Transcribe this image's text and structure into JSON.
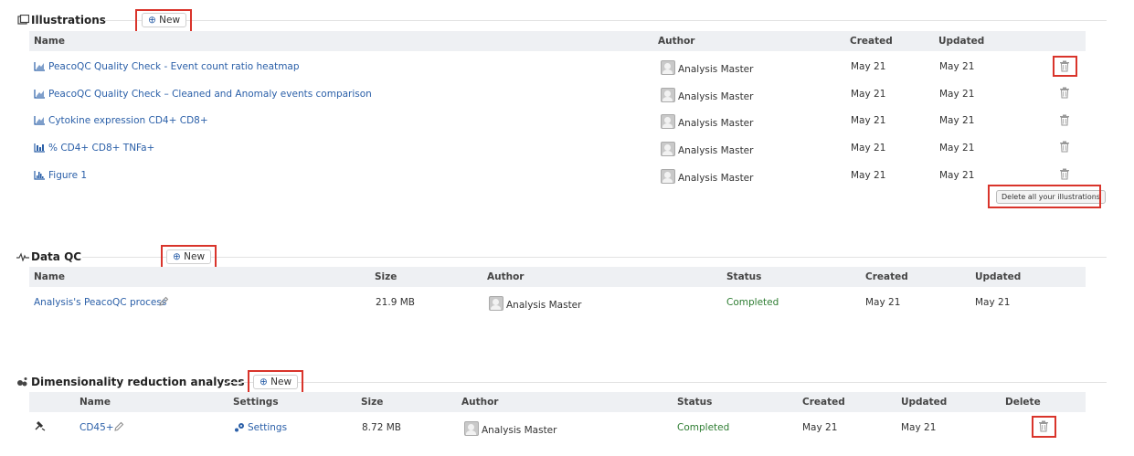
{
  "illustrations": {
    "title": "Illustrations",
    "new_label": "New",
    "columns": {
      "name": "Name",
      "author": "Author",
      "created": "Created",
      "updated": "Updated"
    },
    "rows": [
      {
        "name": "PeacoQC Quality Check - Event count ratio heatmap",
        "author": "Analysis Master",
        "created": "May 21",
        "updated": "May 21"
      },
      {
        "name": "PeacoQC Quality Check – Cleaned and Anomaly events comparison",
        "author": "Analysis Master",
        "created": "May 21",
        "updated": "May 21"
      },
      {
        "name": "Cytokine expression CD4+ CD8+",
        "author": "Analysis Master",
        "created": "May 21",
        "updated": "May 21"
      },
      {
        "name": "% CD4+ CD8+ TNFa+",
        "author": "Analysis Master",
        "created": "May 21",
        "updated": "May 21"
      },
      {
        "name": "Figure 1",
        "author": "Analysis Master",
        "created": "May 21",
        "updated": "May 21"
      }
    ],
    "delete_all_label": "Delete all your illustrations"
  },
  "data_qc": {
    "title": "Data QC",
    "new_label": "New",
    "columns": {
      "name": "Name",
      "size": "Size",
      "author": "Author",
      "status": "Status",
      "created": "Created",
      "updated": "Updated"
    },
    "rows": [
      {
        "name": "Analysis's PeacoQC process",
        "size": "21.9 MB",
        "author": "Analysis Master",
        "status": "Completed",
        "created": "May 21",
        "updated": "May 21"
      }
    ]
  },
  "dimred": {
    "title": "Dimensionality reduction analyses",
    "new_label": "New",
    "columns": {
      "name": "Name",
      "settings": "Settings",
      "size": "Size",
      "author": "Author",
      "status": "Status",
      "created": "Created",
      "updated": "Updated",
      "delete": "Delete"
    },
    "rows": [
      {
        "name": "CD45+",
        "settings": "Settings",
        "size": "8.72 MB",
        "author": "Analysis Master",
        "status": "Completed",
        "created": "May 21",
        "updated": "May 21"
      }
    ]
  },
  "colors": {
    "link": "#2a5fa8",
    "completed": "#2e7d32",
    "highlight": "#d9342b",
    "header_bg": "#eef0f3"
  }
}
